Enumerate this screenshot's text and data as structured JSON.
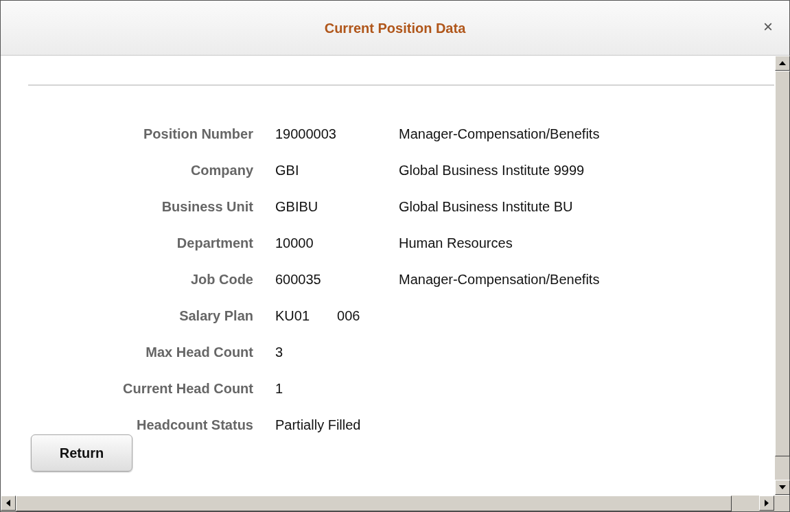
{
  "window": {
    "title": "Current Position Data",
    "close": "×"
  },
  "fields": [
    {
      "label": "Position Number",
      "values": [
        "19000003"
      ],
      "description": "Manager-Compensation/Benefits"
    },
    {
      "label": "Company",
      "values": [
        "GBI"
      ],
      "description": "Global Business Institute 9999"
    },
    {
      "label": "Business Unit",
      "values": [
        "GBIBU"
      ],
      "description": "Global Business Institute BU"
    },
    {
      "label": "Department",
      "values": [
        "10000"
      ],
      "description": "Human Resources"
    },
    {
      "label": "Job Code",
      "values": [
        "600035"
      ],
      "description": "Manager-Compensation/Benefits"
    },
    {
      "label": "Salary Plan",
      "values": [
        "KU01",
        "006"
      ]
    },
    {
      "label": "Max Head Count",
      "values": [
        "3"
      ]
    },
    {
      "label": "Current Head Count",
      "values": [
        "1"
      ]
    },
    {
      "label": "Headcount Status",
      "values": [
        "Partially Filled"
      ]
    }
  ],
  "buttons": [
    "Return"
  ]
}
